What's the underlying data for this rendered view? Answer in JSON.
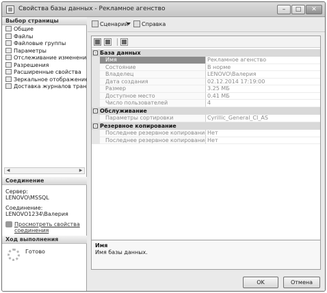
{
  "window": {
    "title": "Свойства базы данных - Рекламное агенство"
  },
  "left_panel": {
    "select_page_header": "Выбор страницы",
    "pages": [
      {
        "label": "Общие"
      },
      {
        "label": "Файлы"
      },
      {
        "label": "Файловые группы"
      },
      {
        "label": "Параметры"
      },
      {
        "label": "Отслеживание изменений"
      },
      {
        "label": "Разрешения"
      },
      {
        "label": "Расширенные свойства"
      },
      {
        "label": "Зеркальное отображение"
      },
      {
        "label": "Доставка журналов транзакций"
      }
    ],
    "connection_header": "Соединение",
    "server_label": "Сервер:",
    "server_value": "LENOVO\\MSSQL",
    "connection_label": "Соединение:",
    "connection_value": "LENOVO1234\\Валерия",
    "view_connection_link": "Просмотреть свойства соединения",
    "progress_header": "Ход выполнения",
    "progress_status": "Готово"
  },
  "toolbar": {
    "script_label": "Сценарий",
    "help_label": "Справка"
  },
  "grid": {
    "categories": [
      {
        "name": "База данных",
        "rows": [
          {
            "key": "Имя",
            "value": "Рекламное агенство",
            "selected": true
          },
          {
            "key": "Состояние",
            "value": "В норме"
          },
          {
            "key": "Владелец",
            "value": "LENOVO\\Валерия"
          },
          {
            "key": "Дата создания",
            "value": "02.12.2014 17:19:00"
          },
          {
            "key": "Размер",
            "value": "3.25 МБ"
          },
          {
            "key": "Доступное место",
            "value": "0.41 МБ"
          },
          {
            "key": "Число пользователей",
            "value": "4"
          }
        ]
      },
      {
        "name": "Обслуживание",
        "rows": [
          {
            "key": "Параметры сортировки",
            "value": "Cyrillic_General_CI_AS"
          }
        ]
      },
      {
        "name": "Резервное копирование",
        "rows": [
          {
            "key": "Последнее резервное копирование базы",
            "value": "Нет"
          },
          {
            "key": "Последнее резервное копирование журна",
            "value": "Нет"
          }
        ]
      }
    ]
  },
  "description": {
    "title": "Имя",
    "text": "Имя базы данных."
  },
  "buttons": {
    "ok": "OK",
    "cancel": "Отмена"
  }
}
